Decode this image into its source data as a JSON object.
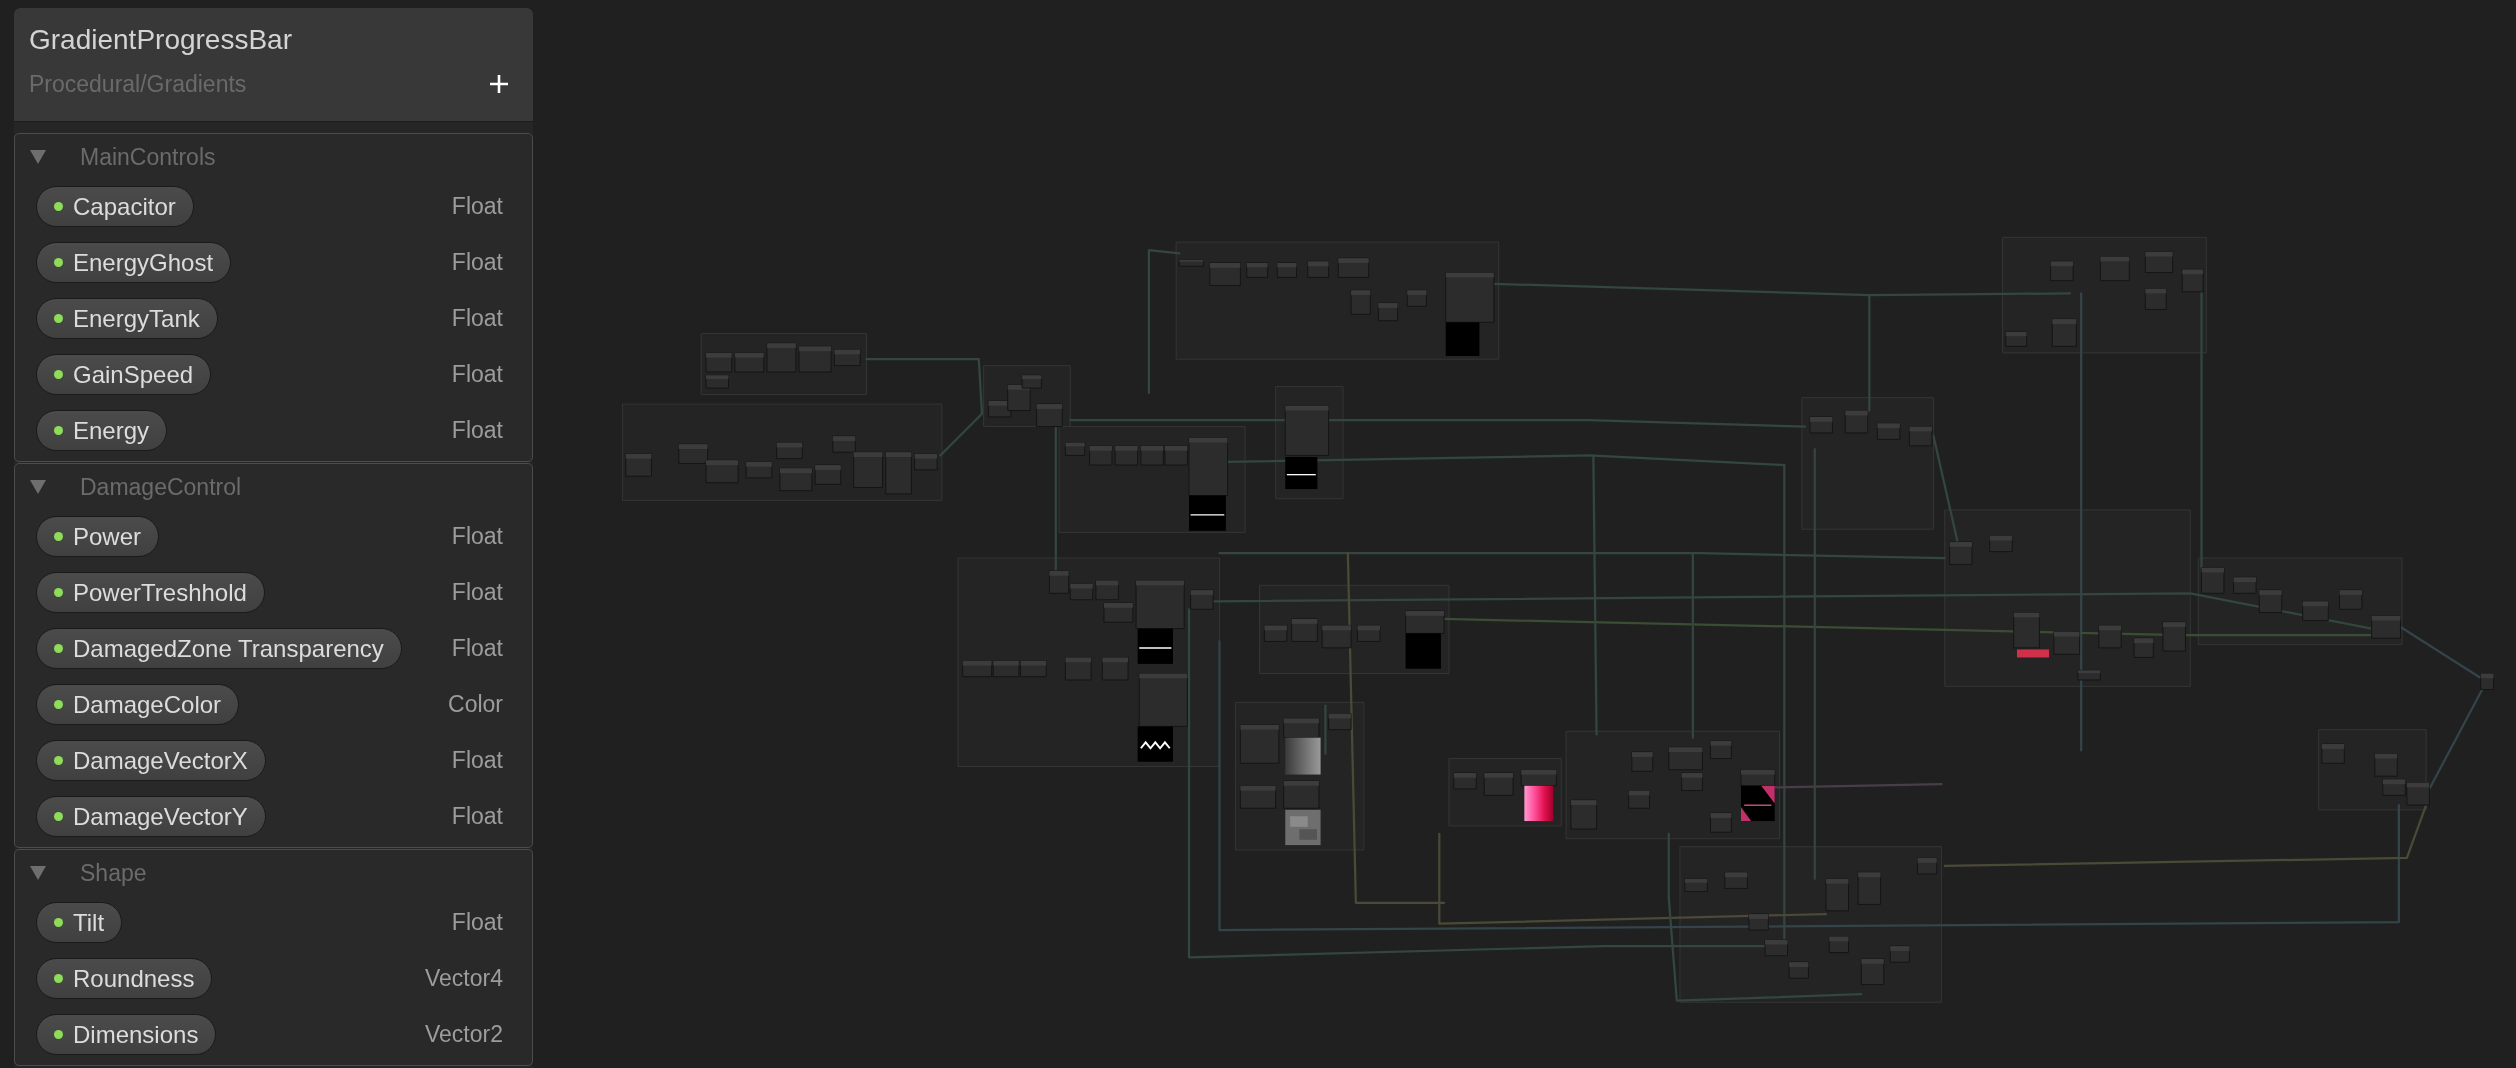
{
  "blackboard": {
    "title": "GradientProgressBar",
    "subtitle": "Procedural/Gradients",
    "categories": [
      {
        "name": "MainControls",
        "expanded": true,
        "properties": [
          {
            "name": "Capacitor",
            "type": "Float"
          },
          {
            "name": "EnergyGhost",
            "type": "Float"
          },
          {
            "name": "EnergyTank",
            "type": "Float"
          },
          {
            "name": "GainSpeed",
            "type": "Float"
          },
          {
            "name": "Energy",
            "type": "Float"
          }
        ]
      },
      {
        "name": "DamageControl",
        "expanded": true,
        "properties": [
          {
            "name": "Power",
            "type": "Float"
          },
          {
            "name": "PowerTreshhold",
            "type": "Float"
          },
          {
            "name": "DamagedZone Transparency",
            "type": "Float"
          },
          {
            "name": "DamageColor",
            "type": "Color"
          },
          {
            "name": "DamageVectorX",
            "type": "Float"
          },
          {
            "name": "DamageVectorY",
            "type": "Float"
          }
        ]
      },
      {
        "name": "Shape",
        "expanded": true,
        "properties": [
          {
            "name": "Tilt",
            "type": "Float"
          },
          {
            "name": "Roundness",
            "type": "Vector4"
          },
          {
            "name": "Dimensions",
            "type": "Vector2"
          }
        ]
      }
    ]
  }
}
